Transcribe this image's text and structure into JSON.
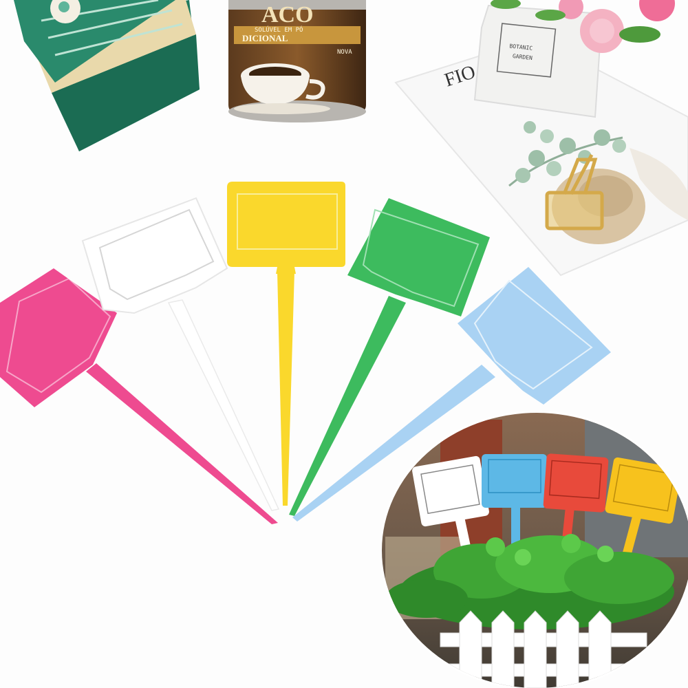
{
  "scene": {
    "can": {
      "brand_fragment": "ACO",
      "line_fragment": "SOLÚVEL EM PÓ",
      "variant_fragment": "DICIONAL",
      "side_fragment": "NOVA"
    },
    "card": {
      "text_fragment": "FIO",
      "pot_label_line1": "BOTANIC",
      "pot_label_line2": "GARDEN"
    }
  },
  "colors": {
    "pink": "#ee4b90",
    "white": "#ffffff",
    "yellow": "#fad82c",
    "green": "#3dbb5e",
    "blue": "#a9d2f3",
    "red": "#e84a3b",
    "gift_box": "#1f7a5e",
    "box_lid": "#f1e4bf",
    "can_band": "#c8963d",
    "background": "#fdfdfd"
  },
  "icons": [
    "gift-box",
    "coffee-can",
    "coffee-cup",
    "flower-pot",
    "binder-clip",
    "plant"
  ]
}
